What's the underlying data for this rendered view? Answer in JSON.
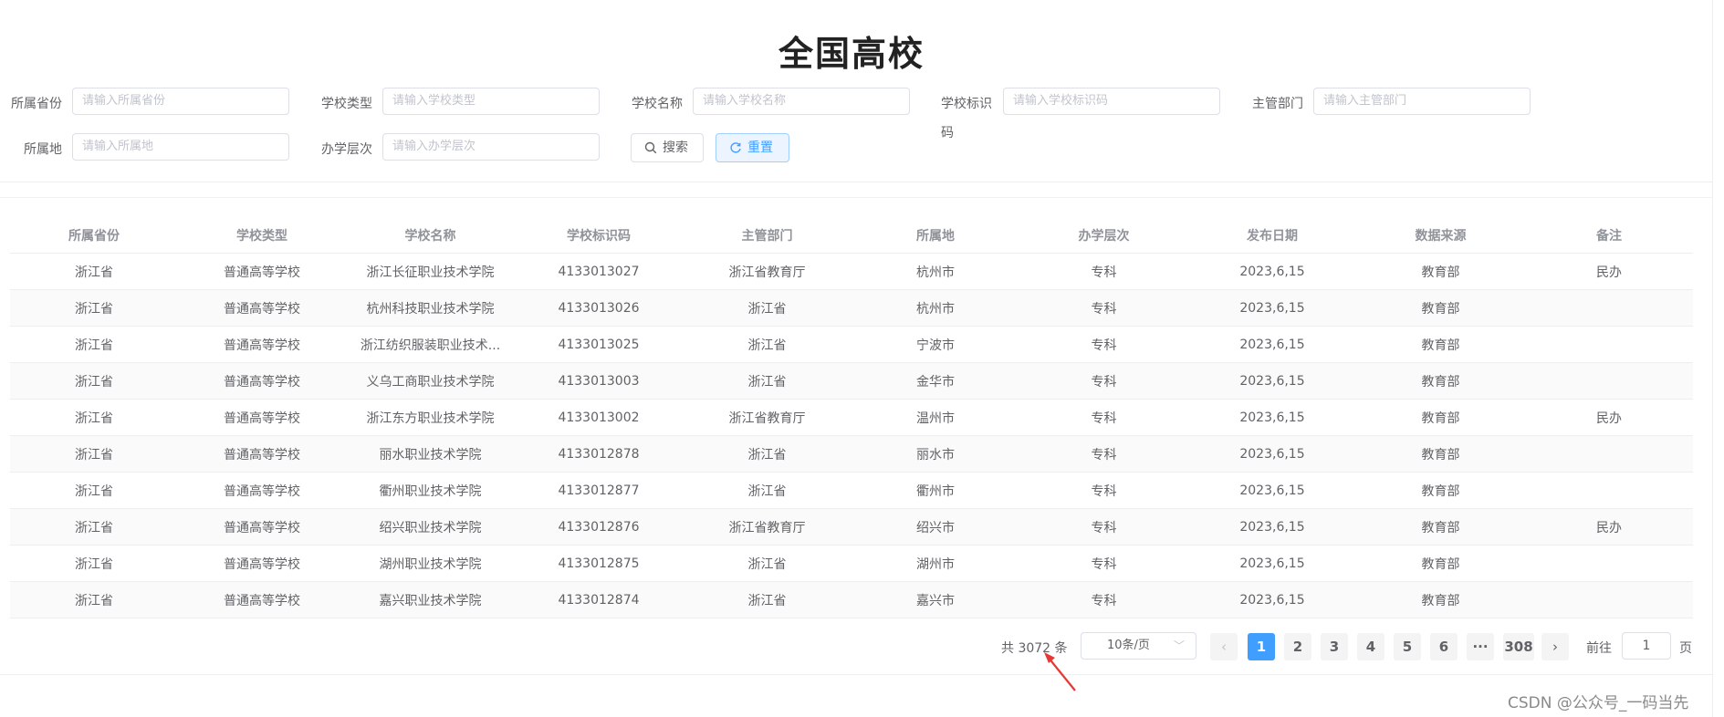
{
  "page_title": "全国高校",
  "filters": {
    "province": {
      "label": "所属省份",
      "placeholder": "请输入所属省份"
    },
    "school_type": {
      "label": "学校类型",
      "placeholder": "请输入学校类型"
    },
    "school_name": {
      "label": "学校名称",
      "placeholder": "请输入学校名称"
    },
    "school_code": {
      "label_line1": "学校标识",
      "label_line2": "码",
      "placeholder": "请输入学校标识码"
    },
    "department": {
      "label": "主管部门",
      "placeholder": "请输入主管部门"
    },
    "city": {
      "label": "所属地",
      "placeholder": "请输入所属地"
    },
    "level": {
      "label": "办学层次",
      "placeholder": "请输入办学层次"
    }
  },
  "buttons": {
    "search": "搜索",
    "reset": "重置",
    "search_icon": "search-icon",
    "reset_icon": "refresh-icon"
  },
  "table": {
    "headers": [
      "所属省份",
      "学校类型",
      "学校名称",
      "学校标识码",
      "主管部门",
      "所属地",
      "办学层次",
      "发布日期",
      "数据来源",
      "备注"
    ],
    "rows": [
      [
        "浙江省",
        "普通高等学校",
        "浙江长征职业技术学院",
        "4133013027",
        "浙江省教育厅",
        "杭州市",
        "专科",
        "2023,6,15",
        "教育部",
        "民办"
      ],
      [
        "浙江省",
        "普通高等学校",
        "杭州科技职业技术学院",
        "4133013026",
        "浙江省",
        "杭州市",
        "专科",
        "2023,6,15",
        "教育部",
        ""
      ],
      [
        "浙江省",
        "普通高等学校",
        "浙江纺织服装职业技术...",
        "4133013025",
        "浙江省",
        "宁波市",
        "专科",
        "2023,6,15",
        "教育部",
        ""
      ],
      [
        "浙江省",
        "普通高等学校",
        "义乌工商职业技术学院",
        "4133013003",
        "浙江省",
        "金华市",
        "专科",
        "2023,6,15",
        "教育部",
        ""
      ],
      [
        "浙江省",
        "普通高等学校",
        "浙江东方职业技术学院",
        "4133013002",
        "浙江省教育厅",
        "温州市",
        "专科",
        "2023,6,15",
        "教育部",
        "民办"
      ],
      [
        "浙江省",
        "普通高等学校",
        "丽水职业技术学院",
        "4133012878",
        "浙江省",
        "丽水市",
        "专科",
        "2023,6,15",
        "教育部",
        ""
      ],
      [
        "浙江省",
        "普通高等学校",
        "衢州职业技术学院",
        "4133012877",
        "浙江省",
        "衢州市",
        "专科",
        "2023,6,15",
        "教育部",
        ""
      ],
      [
        "浙江省",
        "普通高等学校",
        "绍兴职业技术学院",
        "4133012876",
        "浙江省教育厅",
        "绍兴市",
        "专科",
        "2023,6,15",
        "教育部",
        "民办"
      ],
      [
        "浙江省",
        "普通高等学校",
        "湖州职业技术学院",
        "4133012875",
        "浙江省",
        "湖州市",
        "专科",
        "2023,6,15",
        "教育部",
        ""
      ],
      [
        "浙江省",
        "普通高等学校",
        "嘉兴职业技术学院",
        "4133012874",
        "浙江省",
        "嘉兴市",
        "专科",
        "2023,6,15",
        "教育部",
        ""
      ]
    ]
  },
  "pagination": {
    "total_text": "共 3072 条",
    "page_size": "10条/页",
    "pages": [
      "1",
      "2",
      "3",
      "4",
      "5",
      "6"
    ],
    "ellipsis": "···",
    "last_page": "308",
    "current_page": "1",
    "prev": "‹",
    "next": "›",
    "goto_label": "前往",
    "goto_value": "1",
    "goto_suffix": "页"
  },
  "watermark": "CSDN @公众号_一码当先",
  "colors": {
    "primary": "#409eff",
    "annotation_arrow": "#e53935"
  }
}
